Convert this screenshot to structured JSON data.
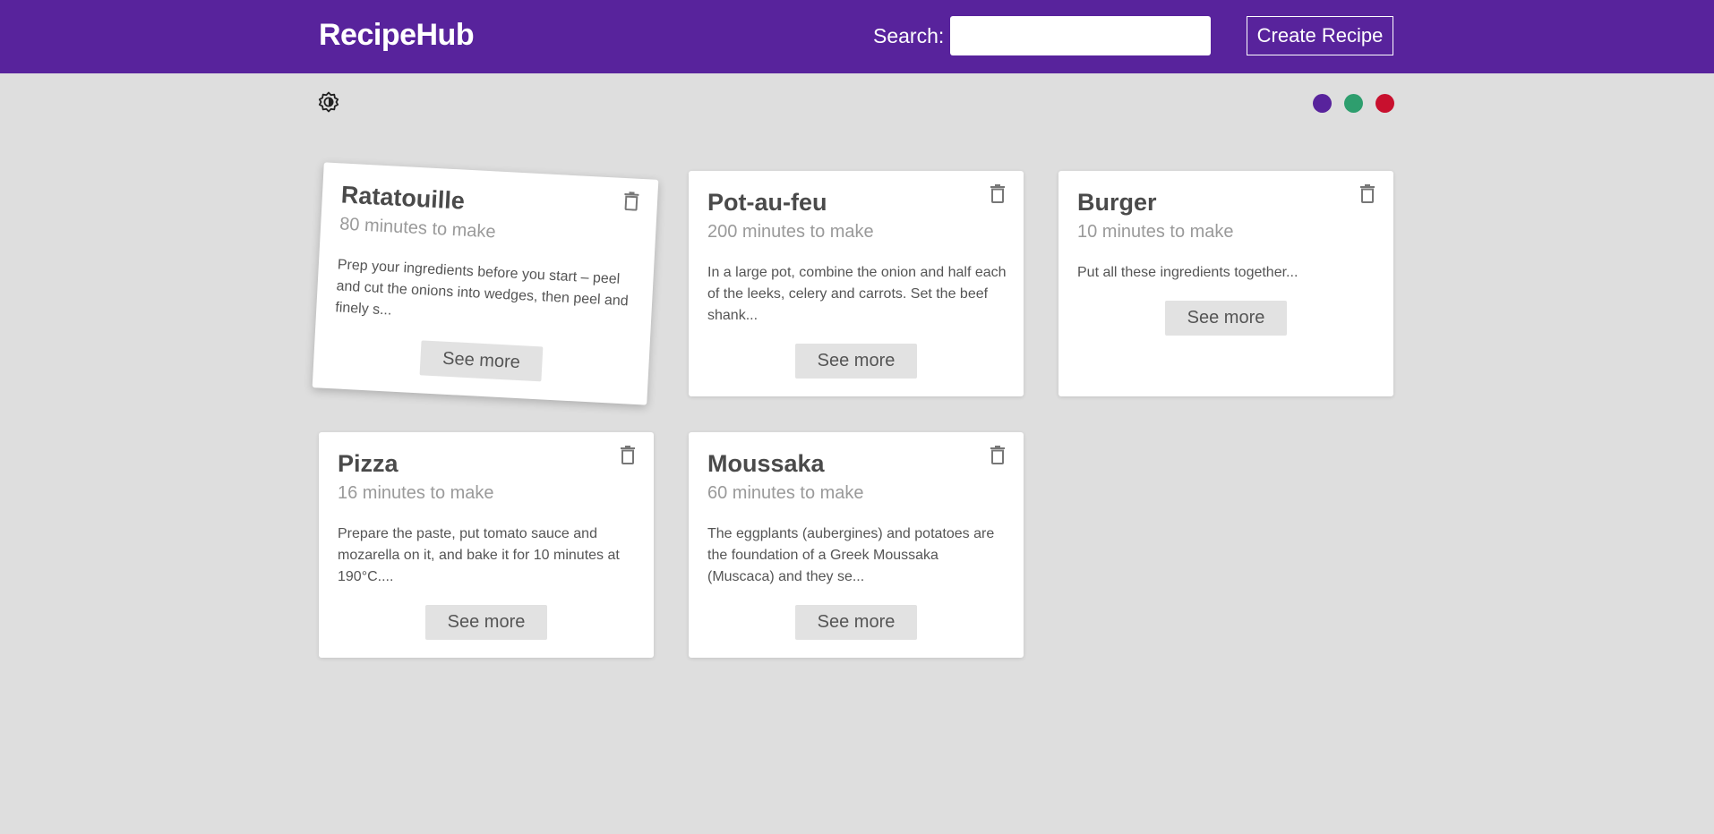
{
  "header": {
    "logo": "RecipeHub",
    "search_label": "Search:",
    "search_value": "",
    "create_label": "Create Recipe"
  },
  "theme": {
    "toggle_icon": "brightness-icon",
    "colors": [
      "#58239c",
      "#2e9e6e",
      "#c8102e"
    ]
  },
  "recipes": [
    {
      "title": "Ratatouille",
      "time": "80 minutes to make",
      "description": "Prep your ingredients before you start – peel and cut the onions into wedges, then peel and finely s...",
      "button": "See more"
    },
    {
      "title": "Pot-au-feu",
      "time": "200 minutes to make",
      "description": "In a large pot, combine the onion and half each of the leeks, celery and carrots. Set the beef shank...",
      "button": "See more"
    },
    {
      "title": "Burger",
      "time": "10 minutes to make",
      "description": "Put all these ingredients together...",
      "button": "See more"
    },
    {
      "title": "Pizza",
      "time": "16 minutes to make",
      "description": "Prepare the paste, put tomato sauce and mozarella on it, and bake it for 10 minutes at 190°C....",
      "button": "See more"
    },
    {
      "title": "Moussaka",
      "time": "60 minutes to make",
      "description": "The eggplants (aubergines) and potatoes are the foundation of a Greek Moussaka (Muscaca) and they se...",
      "button": "See more"
    }
  ]
}
